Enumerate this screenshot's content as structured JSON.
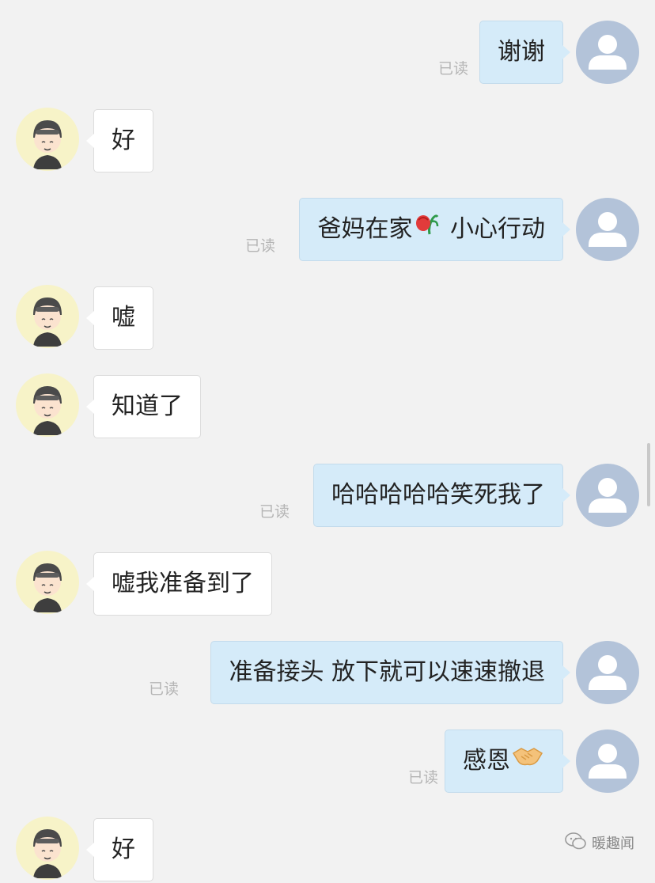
{
  "chat": {
    "messages": [
      {
        "id": "m1",
        "direction": "out",
        "text": "谢谢",
        "read_label": "已读"
      },
      {
        "id": "m2",
        "direction": "in",
        "text": "好"
      },
      {
        "id": "m3",
        "direction": "out",
        "text_before": "爸妈在家",
        "emoji": "rose-emoji",
        "text_after": " 小心行动",
        "read_label": "已读"
      },
      {
        "id": "m4",
        "direction": "in",
        "text": "嘘"
      },
      {
        "id": "m5",
        "direction": "in",
        "text": "知道了"
      },
      {
        "id": "m6",
        "direction": "out",
        "text": "哈哈哈哈哈笑死我了",
        "read_label": "已读"
      },
      {
        "id": "m7",
        "direction": "in",
        "text": "嘘我准备到了"
      },
      {
        "id": "m8",
        "direction": "out",
        "text": "准备接头 放下就可以速速撤退",
        "read_label": "已读"
      },
      {
        "id": "m9",
        "direction": "out",
        "text": "感恩",
        "emoji": "handshake-emoji",
        "read_label": "已读"
      },
      {
        "id": "m10",
        "direction": "in",
        "text": "好"
      }
    ]
  },
  "watermark": {
    "icon": "wechat-icon",
    "label": "暖趣闻"
  },
  "colors": {
    "background": "#f2f2f2",
    "outgoing_bubble": "#d5ebf9",
    "incoming_bubble": "#ffffff",
    "outgoing_avatar": "#b3c3d9",
    "incoming_avatar": "#f7f3c8",
    "read_label": "#b5b5b5"
  }
}
